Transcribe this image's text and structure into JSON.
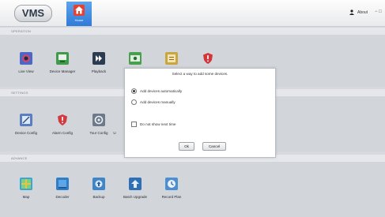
{
  "app": {
    "logo_text": "VMS",
    "home_label": "Home",
    "about_label": "About",
    "window_controls": "− □"
  },
  "sections": [
    {
      "title": "OPERATION",
      "items": [
        {
          "label": "Live View",
          "icon": "live-view-icon",
          "color": "#4a68c9"
        },
        {
          "label": "Device Manager",
          "icon": "device-manager-icon",
          "color": "#3f9a4a"
        },
        {
          "label": "Playback",
          "icon": "playback-icon",
          "color": "#2b3b52"
        },
        {
          "label": "",
          "icon": "recording-icon",
          "color": "#46a04c"
        },
        {
          "label": "",
          "icon": "log-icon",
          "color": "#c9a640"
        },
        {
          "label": "",
          "icon": "shield-icon",
          "color": "#d2363a"
        }
      ]
    },
    {
      "title": "SETTINGS",
      "items": [
        {
          "label": "Device Config",
          "icon": "device-config-icon",
          "color": "#5a7fbf"
        },
        {
          "label": "Alarm Config",
          "icon": "alarm-config-icon",
          "color": "#cf3b3e"
        },
        {
          "label": "Tour Config",
          "icon": "tour-config-icon",
          "color": "#6c7a8a"
        },
        {
          "label": "U",
          "icon": "user-icon",
          "color": "#d2d5da"
        }
      ]
    },
    {
      "title": "ADVANCE",
      "items": [
        {
          "label": "Map",
          "icon": "map-icon",
          "color": "#3aa6d8"
        },
        {
          "label": "Decoder",
          "icon": "decoder-icon",
          "color": "#2f7fc8"
        },
        {
          "label": "Backup",
          "icon": "backup-icon",
          "color": "#3e86c9"
        },
        {
          "label": "Batch Upgrade",
          "icon": "batch-upgrade-icon",
          "color": "#2f6fb8"
        },
        {
          "label": "Record Plan",
          "icon": "record-plan-icon",
          "color": "#4b8fd0"
        }
      ]
    }
  ],
  "dialog": {
    "title": "Select a way to add some devices.",
    "option_auto": "Add devices automatically",
    "option_manual": "Add devices manually",
    "selected": "auto",
    "dont_show": "Do not show next time",
    "ok_label": "Ok",
    "cancel_label": "Cancel"
  }
}
